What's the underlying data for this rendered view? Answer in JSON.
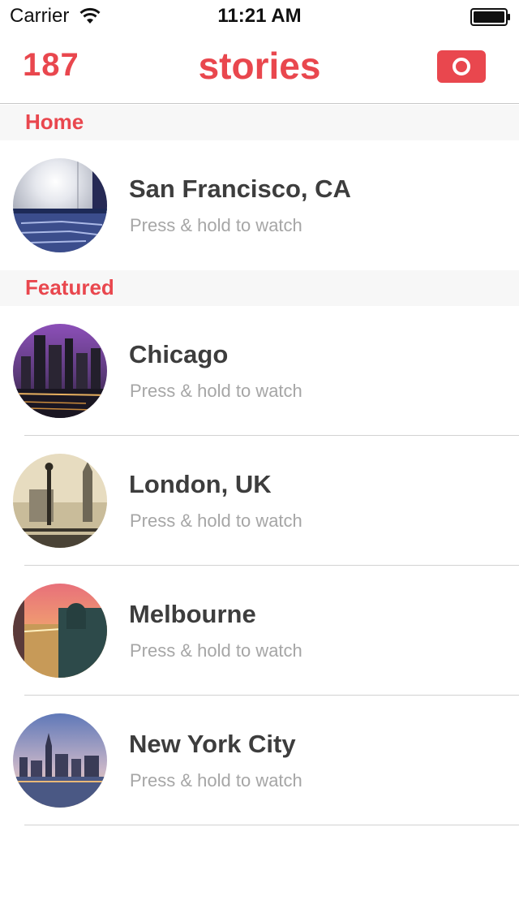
{
  "status_bar": {
    "carrier": "Carrier",
    "time": "11:21 AM"
  },
  "nav": {
    "count": "187",
    "title": "stories",
    "accent_color": "#e9474e"
  },
  "sections": {
    "home": {
      "label": "Home",
      "items": [
        {
          "title": "San Francisco, CA",
          "hint": "Press & hold to watch"
        }
      ]
    },
    "featured": {
      "label": "Featured",
      "items": [
        {
          "title": "Chicago",
          "hint": "Press & hold to watch"
        },
        {
          "title": "London, UK",
          "hint": "Press & hold to watch"
        },
        {
          "title": "Melbourne",
          "hint": "Press & hold to watch"
        },
        {
          "title": "New York City",
          "hint": "Press & hold to watch"
        }
      ]
    }
  },
  "icons": {
    "status": [
      "wifi-icon",
      "battery-icon"
    ],
    "nav": [
      "camera-icon"
    ]
  }
}
